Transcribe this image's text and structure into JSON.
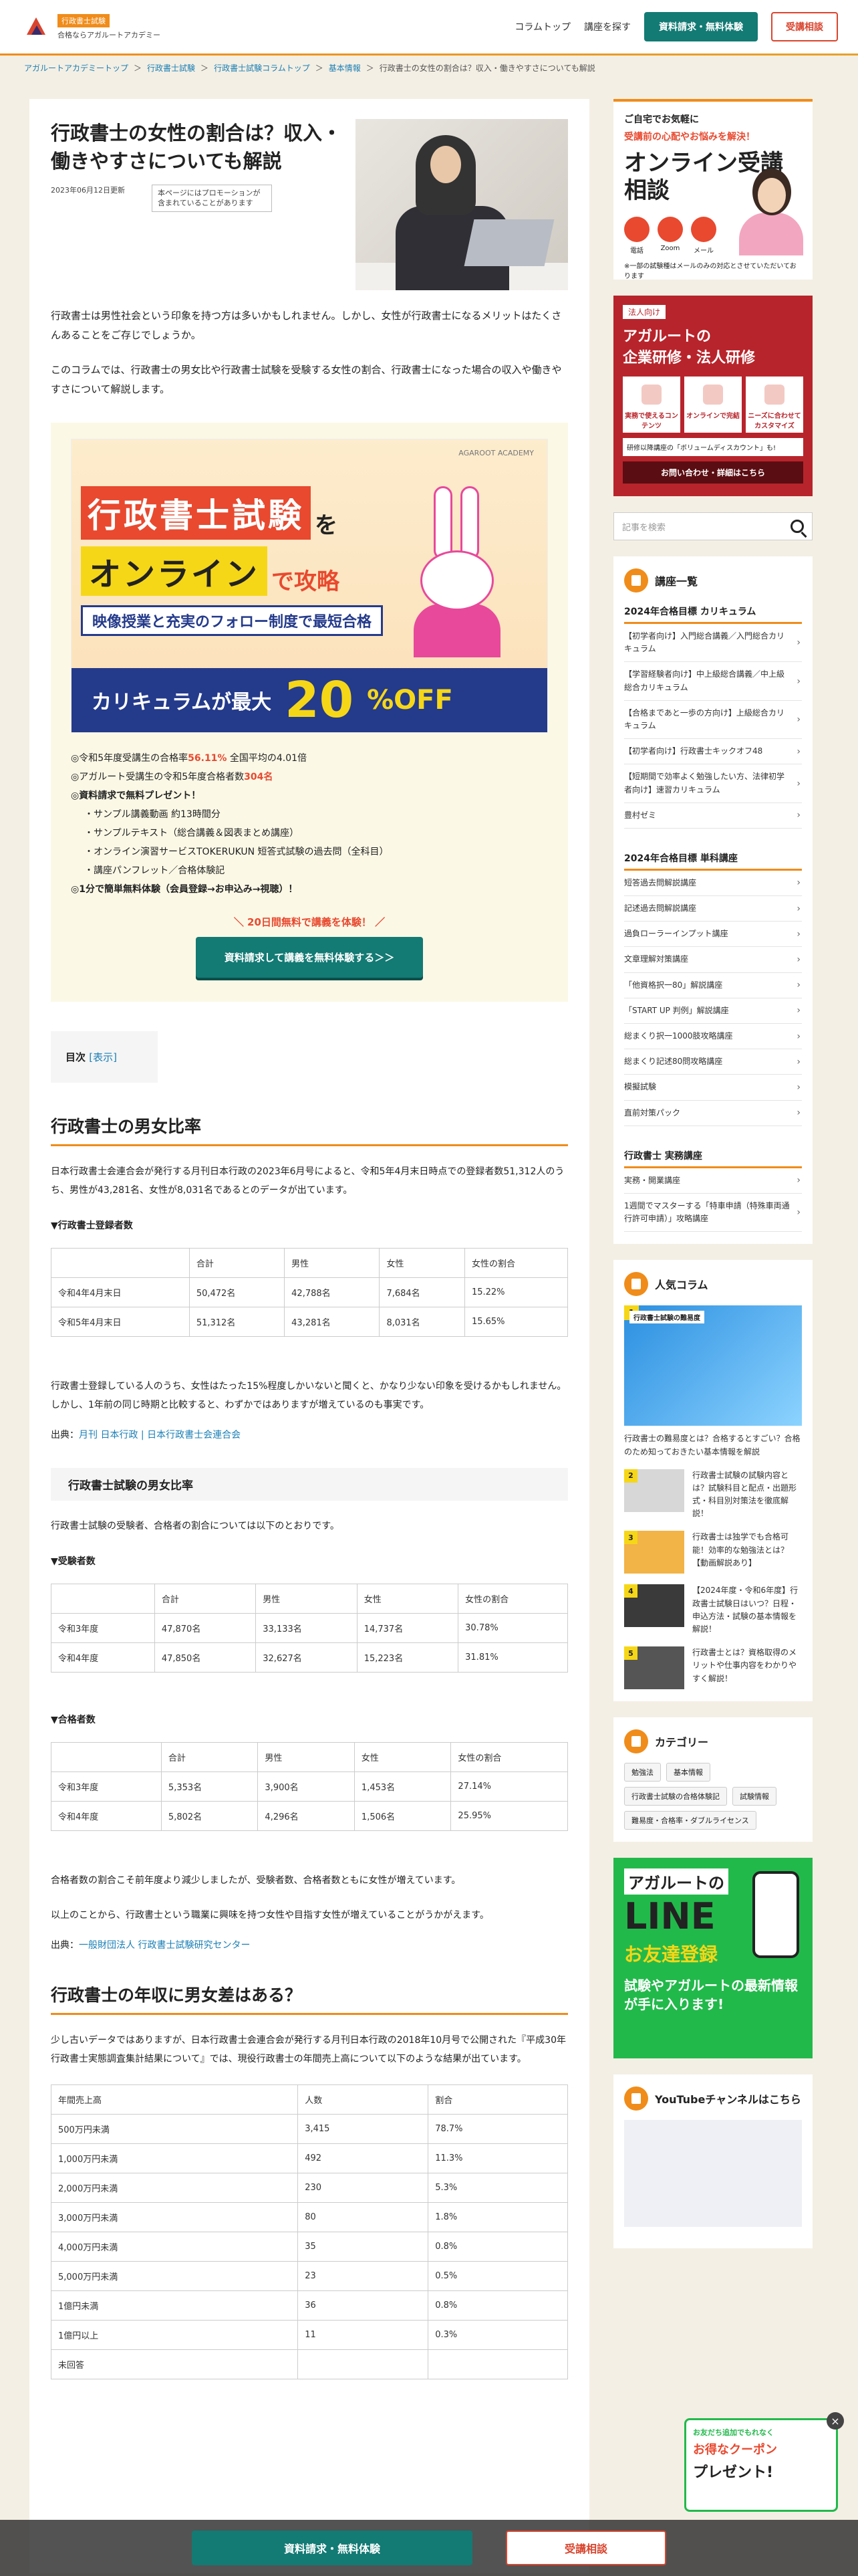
{
  "header": {
    "logo_badge": "行政書士試験",
    "logo_sub": "合格ならアガルートアカデミー",
    "nav": [
      "コラムトップ",
      "講座を探す"
    ],
    "cta_primary": "資料請求・無料体験",
    "cta_secondary": "受講相談"
  },
  "breadcrumb": [
    "アガルートアカデミートップ",
    "行政書士試験",
    "行政書士試験コラムトップ",
    "基本情報",
    "行政書士の女性の割合は？収入・働きやすさについても解説"
  ],
  "article": {
    "title": "行政書士の女性の割合は？収入・働きやすさについても解説",
    "date": "2023年06月12日更新",
    "promo_note": "本ページにはプロモーションが含まれていることがあります",
    "lead1": "行政書士は男性社会という印象を持つ方は多いかもしれません。しかし、女性が行政書士になるメリットはたくさんあることをご存じでしょうか。",
    "lead2": "このコラムでは、行政書士の男女比や行政書士試験を受験する女性の割合、行政書士になった場合の収入や働きやすさについて解説します。"
  },
  "ad": {
    "mark": "AGAROOT ACADEMY",
    "title_red": "行政書士試験",
    "title_red_suffix": "を",
    "title_yellow": "オンライン",
    "title_yellow_suffix": "で攻略",
    "subtitle": "映像授業と充実のフォロー制度で最短合格",
    "bottom_text": "カリキュラムが最大",
    "bottom_num": "20",
    "bottom_off": "%OFF",
    "list": [
      {
        "pre": "令和5年度受講生の合格率",
        "hl": "56.11%",
        "post": " 全国平均の4.01倍"
      },
      {
        "pre": "アガルート受講生の令和5年度合格者数",
        "hl": "304名",
        "post": ""
      },
      {
        "pre": "資料請求で無料プレゼント！",
        "hl": "",
        "post": ""
      }
    ],
    "sublist": [
      "・サンプル講義動画 約13時間分",
      "・サンプルテキスト（総合講義＆図表まとめ講座）",
      "・オンライン演習サービスTOKERUKUN 短答式試験の過去問（全科目）",
      "・講座パンフレット／合格体験記"
    ],
    "last": "1分で簡単無料体験（会員登録→お申込み→視聴）！",
    "cta_note": "＼ 20日間無料で講義を体験！ ／",
    "cta": "資料請求して講義を無料体験する＞＞"
  },
  "toc": {
    "label": "目次",
    "show": "[表示]"
  },
  "section1": {
    "h2": "行政書士の男女比率",
    "p1": "日本行政書士会連合会が発行する月刊日本行政の2023年6月号によると、令和5年4月末日時点での登録者数51,312人のうち、男性が43,281名、女性が8,031名であるとのデータが出ています。",
    "table_label": "▼行政書士登録者数",
    "table": [
      [
        "",
        "合計",
        "男性",
        "女性",
        "女性の割合"
      ],
      [
        "令和4年4月末日",
        "50,472名",
        "42,788名",
        "7,684名",
        "15.22%"
      ],
      [
        "令和5年4月末日",
        "51,312名",
        "43,281名",
        "8,031名",
        "15.65%"
      ]
    ],
    "p2": "行政書士登録している人のうち、女性はたった15%程度しかいないと聞くと、かなり少ない印象を受けるかもしれません。しかし、1年前の同じ時期と比較すると、わずかではありますが増えているのも事実です。",
    "src_label": "出典：",
    "src_link": "月刊 日本行政 | 日本行政書士会連合会"
  },
  "section2": {
    "h3": "行政書士試験の男女比率",
    "p1": "行政書士試験の受験者、合格者の割合については以下のとおりです。",
    "t1_label": "▼受験者数",
    "t1": [
      [
        "",
        "合計",
        "男性",
        "女性",
        "女性の割合"
      ],
      [
        "令和3年度",
        "47,870名",
        "33,133名",
        "14,737名",
        "30.78%"
      ],
      [
        "令和4年度",
        "47,850名",
        "32,627名",
        "15,223名",
        "31.81%"
      ]
    ],
    "t2_label": "▼合格者数",
    "t2": [
      [
        "",
        "合計",
        "男性",
        "女性",
        "女性の割合"
      ],
      [
        "令和3年度",
        "5,353名",
        "3,900名",
        "1,453名",
        "27.14%"
      ],
      [
        "令和4年度",
        "5,802名",
        "4,296名",
        "1,506名",
        "25.95%"
      ]
    ],
    "p2": "合格者数の割合こそ前年度より減少しましたが、受験者数、合格者数ともに女性が増えています。",
    "p3": "以上のことから、行政書士という職業に興味を持つ女性や目指す女性が増えていることがうかがえます。",
    "src_label": "出典：",
    "src_link": "一般財団法人 行政書士試験研究センター"
  },
  "section3": {
    "h2": "行政書士の年収に男女差はある？",
    "p1": "少し古いデータではありますが、日本行政書士会連合会が発行する月刊日本行政の2018年10月号で公開された『平成30年行政書士実態調査集計結果について』では、現役行政書士の年間売上高について以下のような結果が出ています。",
    "table": [
      [
        "年間売上高",
        "人数",
        "割合"
      ],
      [
        "500万円未満",
        "3,415",
        "78.7%"
      ],
      [
        "1,000万円未満",
        "492",
        "11.3%"
      ],
      [
        "2,000万円未満",
        "230",
        "5.3%"
      ],
      [
        "3,000万円未満",
        "80",
        "1.8%"
      ],
      [
        "4,000万円未満",
        "35",
        "0.8%"
      ],
      [
        "5,000万円未満",
        "23",
        "0.5%"
      ],
      [
        "1億円未満",
        "36",
        "0.8%"
      ],
      [
        "1億円以上",
        "11",
        "0.3%"
      ],
      [
        "未回答",
        "",
        ""
      ]
    ]
  },
  "sidebar": {
    "online": {
      "l1": "ご自宅でお気軽に",
      "l2": "受講前の心配やお悩みを解決！",
      "l3": "オンライン受講相談",
      "icons": [
        "電話",
        "Zoom",
        "メール"
      ],
      "note": "※一部の試験種はメールのみの対応とさせていただいております"
    },
    "corp": {
      "tag": "法人向け",
      "t1": "アガルートの",
      "t2": "企業研修・法人研修",
      "boxes": [
        "実務で使えるコンテンツ",
        "オンラインで完結",
        "ニーズに合わせてカスタマイズ"
      ],
      "note": "研修以降講座の「ボリュームディスカウント」も!",
      "btn": "お問い合わせ・詳細はこちら"
    },
    "search_placeholder": "記事を検索",
    "courses": {
      "title": "講座一覧",
      "g1": "2024年合格目標 カリキュラム",
      "g1_items": [
        "【初学者向け】入門総合講義／入門総合カリキュラム",
        "【学習経験者向け】中上級総合講義／中上級総合カリキュラム",
        "【合格まであと一歩の方向け】上級総合カリキュラム",
        "【初学者向け】行政書士キックオフ48",
        "【短期間で効率よく勉強したい方、法律初学者向け】速習カリキュラム",
        "豊村ゼミ"
      ],
      "g2": "2024年合格目標 単科講座",
      "g2_items": [
        "短答過去問解説講座",
        "記述過去問解説講座",
        "過負ローラーインプット講座",
        "文章理解対策講座",
        "「他資格択一80」解説講座",
        "「START UP 判例」解説講座",
        "総まくり択一1000肢攻略講座",
        "総まくり記述80問攻略講座",
        "模擬試験",
        "直前対策パック"
      ],
      "g3": "行政書士 実務講座",
      "g3_items": [
        "実務・開業講座",
        "1週間でマスターする「特車申請（特殊車両通行許可申請）」攻略講座"
      ]
    },
    "popular": {
      "title": "人気コラム",
      "items": [
        {
          "num": "1",
          "label": "行政書士試験の難易度",
          "text": "行政書士の難易度とは？合格するとすごい？合格のため知っておきたい基本情報を解説"
        },
        {
          "num": "2",
          "label": "",
          "text": "行政書士試験の試験内容とは？試験科目と配点・出題形式・科目別対策法を徹底解説！"
        },
        {
          "num": "3",
          "label": "",
          "text": "行政書士は独学でも合格可能！効率的な勉強法とは？【動画解説あり】"
        },
        {
          "num": "4",
          "label": "",
          "text": "【2024年度・令和6年度】行政書士試験日はいつ？日程・申込方法・試験の基本情報を解説！"
        },
        {
          "num": "5",
          "label": "",
          "text": "行政書士とは？資格取得のメリットや仕事内容をわかりやすく解説！"
        }
      ]
    },
    "category": {
      "title": "カテゴリー",
      "tags": [
        "勉強法",
        "基本情報",
        "行政書士試験の合格体験記",
        "試験情報",
        "難易度・合格率・ダブルライセンス"
      ]
    },
    "line": {
      "l1": "アガルートの",
      "l2": "LINE",
      "l3": "お友達登録",
      "l4": "試験やアガルートの最新情報が手に入ります!"
    },
    "youtube": {
      "title": "YouTubeチャンネルはこちら"
    }
  },
  "coupon": {
    "c1": "お友だち追加でもれなく",
    "c2": "お得なクーポン",
    "c3": "プレゼント!",
    "close": "×"
  },
  "fixed_bar": {
    "primary": "資料請求・無料体験",
    "secondary": "受講相談"
  }
}
